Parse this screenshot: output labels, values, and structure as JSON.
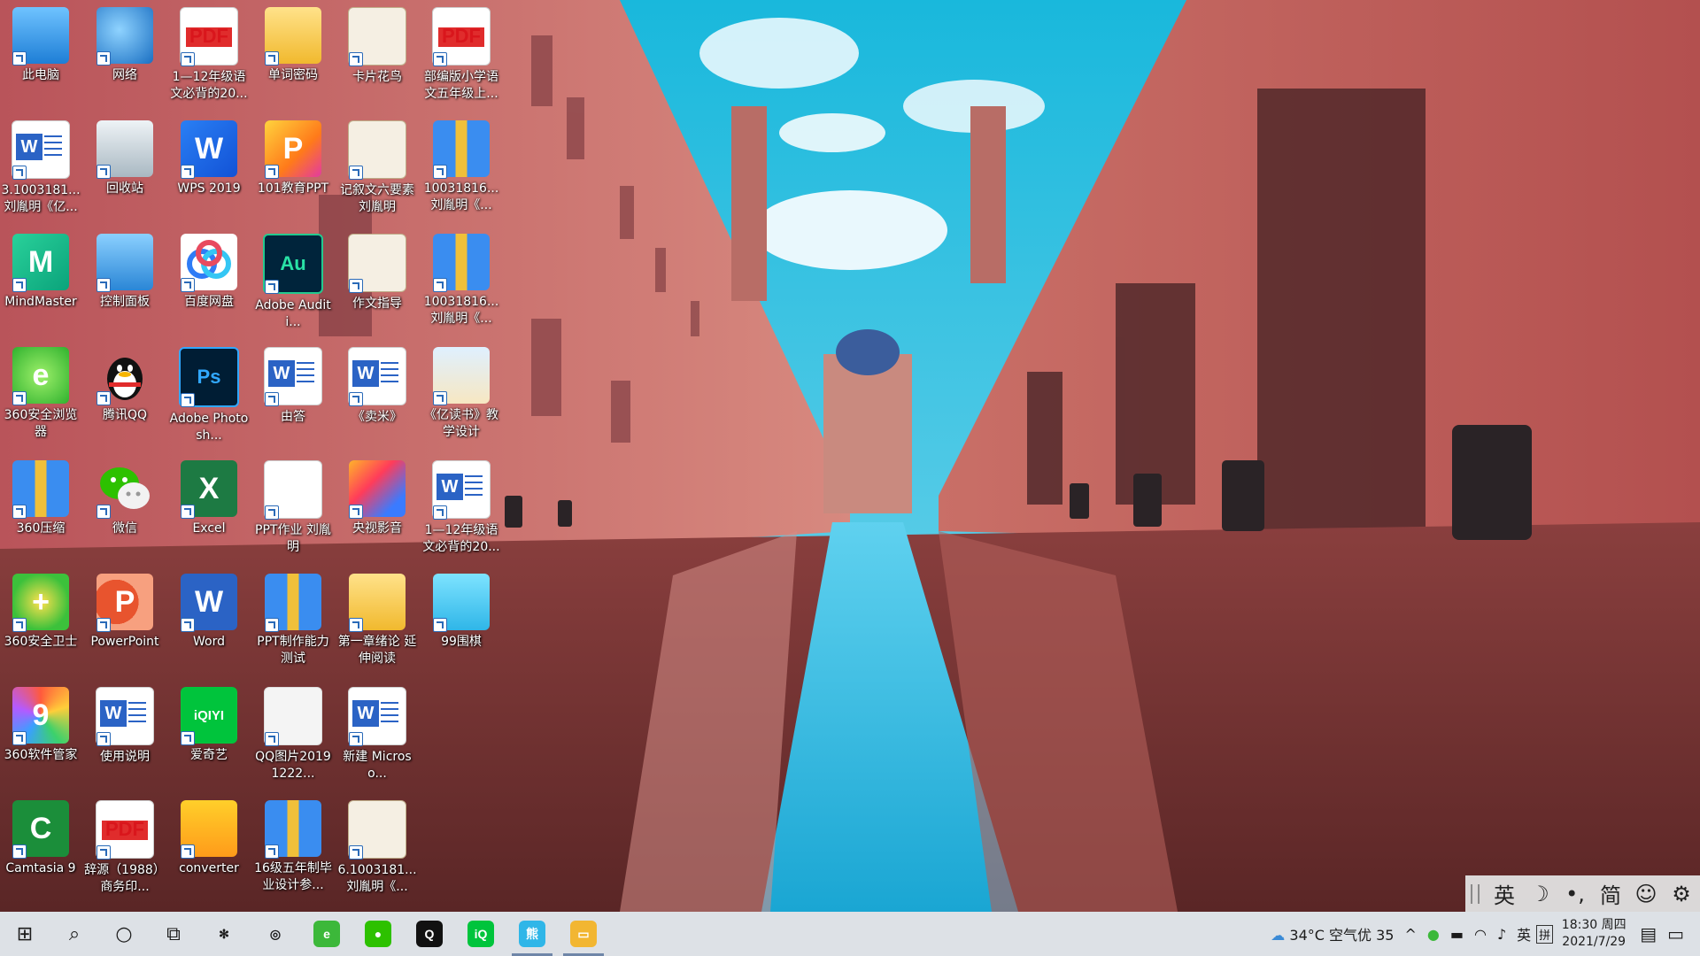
{
  "desktop": {
    "icons": [
      {
        "label": "此电脑",
        "skin": "pc",
        "icon": "computer-icon"
      },
      {
        "label": "网络",
        "skin": "net",
        "icon": "network-icon"
      },
      {
        "label": "1—12年级语文必背的20...",
        "skin": "pdf",
        "icon": "pdf-file-icon",
        "glyph": "PDF"
      },
      {
        "label": "单词密码",
        "skin": "folder",
        "icon": "folder-icon"
      },
      {
        "label": "卡片花鸟",
        "skin": "card",
        "icon": "presentation-file-icon"
      },
      {
        "label": "部编版小学语文五年级上...",
        "skin": "pdf",
        "icon": "pdf-file-icon",
        "glyph": "PDF"
      },
      {
        "label": "3.1003181...刘胤明《亿...",
        "skin": "docw",
        "icon": "word-document-icon",
        "glyph": "W"
      },
      {
        "label": "回收站",
        "skin": "recycle",
        "icon": "recycle-bin-icon"
      },
      {
        "label": "WPS 2019",
        "skin": "wps",
        "icon": "wps-office-icon",
        "glyph": "W"
      },
      {
        "label": "101教育PPT",
        "skin": "ppt101",
        "icon": "ppt101-app-icon",
        "glyph": "P"
      },
      {
        "label": "记叙文六要素 刘胤明",
        "skin": "card",
        "icon": "presentation-file-icon"
      },
      {
        "label": "10031816...刘胤明《...",
        "skin": "zip",
        "icon": "archive-file-icon"
      },
      {
        "label": "MindMaster",
        "skin": "mind",
        "icon": "mindmaster-app-icon",
        "glyph": "M"
      },
      {
        "label": "控制面板",
        "skin": "ctrl",
        "icon": "control-panel-icon"
      },
      {
        "label": "百度网盘",
        "skin": "baidu",
        "icon": "baidu-netdisk-icon"
      },
      {
        "label": "Adobe Auditi...",
        "skin": "au",
        "icon": "adobe-audition-icon",
        "glyph": "Au"
      },
      {
        "label": "作文指导",
        "skin": "card",
        "icon": "presentation-file-icon"
      },
      {
        "label": "10031816...刘胤明《...",
        "skin": "zip",
        "icon": "archive-file-icon"
      },
      {
        "label": "360安全浏览器",
        "skin": "360e",
        "icon": "360-browser-icon",
        "glyph": "e"
      },
      {
        "label": "腾讯QQ",
        "skin": "qq",
        "icon": "qq-penguin-icon"
      },
      {
        "label": "Adobe Photosh...",
        "skin": "ps",
        "icon": "adobe-photoshop-icon",
        "glyph": "Ps"
      },
      {
        "label": "由答",
        "skin": "docw",
        "icon": "word-document-icon",
        "glyph": "W"
      },
      {
        "label": "《卖米》",
        "skin": "docw",
        "icon": "word-document-icon",
        "glyph": "W"
      },
      {
        "label": "《亿读书》教学设计",
        "skin": "book",
        "icon": "presentation-file-icon"
      },
      {
        "label": "360压缩",
        "skin": "zip",
        "icon": "archive-app-icon"
      },
      {
        "label": "微信",
        "skin": "wechat",
        "icon": "wechat-icon"
      },
      {
        "label": "Excel",
        "skin": "excel",
        "icon": "excel-app-icon",
        "glyph": "X"
      },
      {
        "label": "PPT作业 刘胤明",
        "skin": "ppt",
        "icon": "powerpoint-file-icon",
        "glyph": "P"
      },
      {
        "label": "央视影音",
        "skin": "cctv",
        "icon": "cctv-video-icon"
      },
      {
        "label": "1—12年级语文必背的20...",
        "skin": "docw",
        "icon": "word-document-icon",
        "glyph": "W"
      },
      {
        "label": "360安全卫士",
        "skin": "360g",
        "icon": "360-guard-icon",
        "glyph": "+"
      },
      {
        "label": "PowerPoint",
        "skin": "pp",
        "icon": "powerpoint-app-icon",
        "glyph": "P"
      },
      {
        "label": "Word",
        "skin": "word",
        "icon": "word-app-icon",
        "glyph": "W"
      },
      {
        "label": "PPT制作能力测试",
        "skin": "zip",
        "icon": "archive-file-icon"
      },
      {
        "label": "第一章绪论 延伸阅读",
        "skin": "folder",
        "icon": "folder-icon"
      },
      {
        "label": "99围棋",
        "skin": "panda",
        "icon": "99-weiqi-game-icon"
      },
      {
        "label": "360软件管家",
        "skin": "360s",
        "icon": "360-software-manager-icon",
        "glyph": "9"
      },
      {
        "label": "使用说明",
        "skin": "docw",
        "icon": "word-document-icon",
        "glyph": "W"
      },
      {
        "label": "爱奇艺",
        "skin": "iqiyi",
        "icon": "iqiyi-app-icon",
        "glyph": "iQIYI"
      },
      {
        "label": "QQ图片20191222...",
        "skin": "photo",
        "icon": "image-file-icon"
      },
      {
        "label": "新建 Microso...",
        "skin": "docw",
        "icon": "word-document-icon",
        "glyph": "W"
      },
      {
        "label": "",
        "skin": "none",
        "icon": ""
      },
      {
        "label": "Camtasia 9",
        "skin": "camtasia",
        "icon": "camtasia-app-icon",
        "glyph": "C"
      },
      {
        "label": "辞源（1988）商务印...",
        "skin": "pdf",
        "icon": "pdf-file-icon",
        "glyph": "PDF"
      },
      {
        "label": "converter",
        "skin": "conv",
        "icon": "converter-app-icon"
      },
      {
        "label": "16级五年制毕业设计参...",
        "skin": "zip",
        "icon": "archive-file-icon"
      },
      {
        "label": "6.1003181...刘胤明《...",
        "skin": "card",
        "icon": "presentation-file-icon"
      }
    ]
  },
  "ime": {
    "items": [
      "英",
      "☽",
      "•,",
      "简",
      "☺",
      "⚙"
    ]
  },
  "taskbar": {
    "start_glyph": "⊞",
    "search_glyph": "⌕",
    "cortana_glyph": "○",
    "taskview_glyph": "⧉",
    "apps": [
      {
        "name": "taskbar-app-pinwheel",
        "color": "#1b1b1b",
        "glyph": "✻",
        "active": false
      },
      {
        "name": "taskbar-app-search-tool",
        "color": "#1b1b1b",
        "glyph": "◎",
        "active": false
      },
      {
        "name": "taskbar-app-360-browser",
        "color": "#3cb83a",
        "glyph": "e",
        "active": false
      },
      {
        "name": "taskbar-app-wechat",
        "color": "#2dc100",
        "glyph": "●",
        "active": false
      },
      {
        "name": "taskbar-app-qq",
        "color": "#111111",
        "glyph": "Q",
        "active": false
      },
      {
        "name": "taskbar-app-iqiyi",
        "color": "#00c43c",
        "glyph": "iQ",
        "active": false
      },
      {
        "name": "taskbar-app-99-weiqi",
        "color": "#2fb6e8",
        "glyph": "熊",
        "active": true
      },
      {
        "name": "taskbar-app-file-explorer",
        "color": "#f2b632",
        "glyph": "▭",
        "active": true
      }
    ],
    "weather": {
      "temp": "34°C",
      "aqi": "空气优 35"
    },
    "tray_lang": "英",
    "tray_ime": "拼",
    "time": "18:30 周四",
    "date": "2021/7/29"
  }
}
